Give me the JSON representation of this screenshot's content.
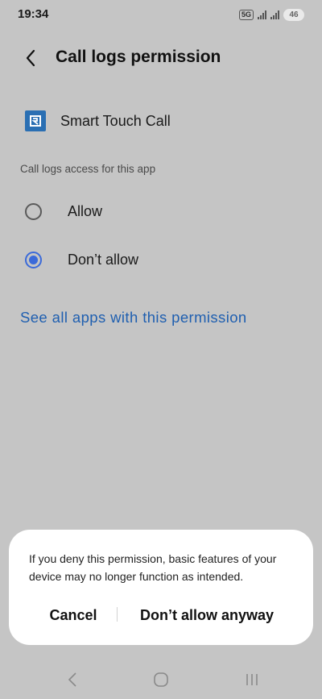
{
  "status_bar": {
    "time": "19:34",
    "network_badge": "5G",
    "battery": "46"
  },
  "header": {
    "back_icon": "chevron-left-icon",
    "title": "Call logs permission"
  },
  "app": {
    "icon": "smart-touch-call-app-icon",
    "name": "Smart Touch Call"
  },
  "section": {
    "label": "Call logs access for this app"
  },
  "options": [
    {
      "label": "Allow",
      "selected": false
    },
    {
      "label": "Don’t allow",
      "selected": true
    }
  ],
  "link": {
    "label": "See all apps with this permission",
    "color": "#1f5fb0"
  },
  "dialog": {
    "message": "If you deny this permission, basic features of your device may no longer function as intended.",
    "cancel_label": "Cancel",
    "confirm_label": "Don’t allow anyway"
  },
  "nav_bar": {
    "back_icon": "nav-back-icon",
    "home_icon": "nav-home-icon",
    "recents_icon": "nav-recents-icon"
  },
  "colors": {
    "accent": "#3b6ad9",
    "background": "#c5c5c5",
    "dialog": "#ffffff"
  }
}
